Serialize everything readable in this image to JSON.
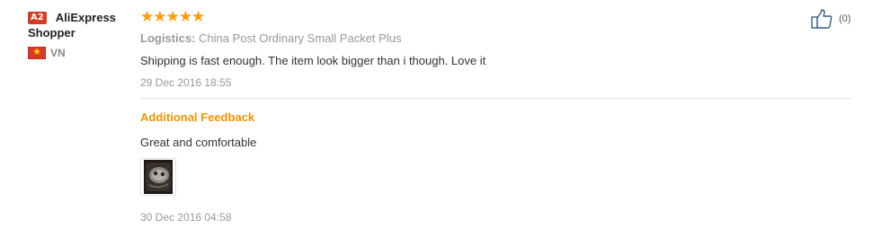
{
  "user": {
    "level_badge": "A2",
    "name_line1": "AliExpress",
    "name_line2": "Shopper",
    "country_code": "VN",
    "flag_icon": "vietnam-flag-icon"
  },
  "review": {
    "rating": 5,
    "rating_stars": "★★★★★",
    "logistics_label": "Logistics:",
    "logistics_value": " China Post Ordinary Small Packet Plus",
    "text": "Shipping is fast enough. The item look bigger than i though. Love it",
    "date": "29 Dec 2016 18:55"
  },
  "additional_feedback": {
    "title": "Additional Feedback",
    "text": "Great and comfortable",
    "date": "30 Dec 2016 04:58"
  },
  "helpful": {
    "icon": "thumbs-up-icon",
    "count": "(0)"
  },
  "colors": {
    "star": "#ff9c00",
    "feedback_title": "#f29500",
    "badge": "#d63b24"
  }
}
